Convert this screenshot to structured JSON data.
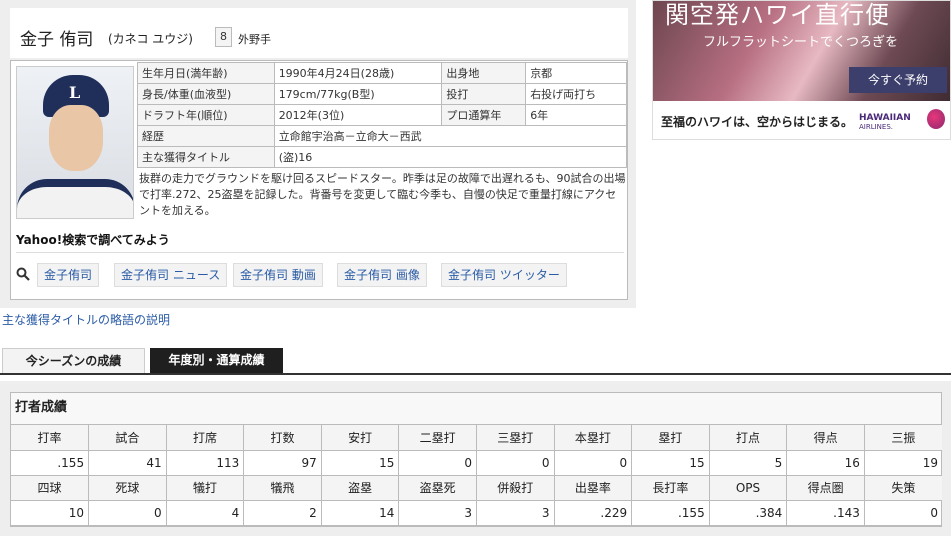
{
  "player": {
    "name": "金子 侑司",
    "kana": "(カネコ ユウジ)",
    "number": "8",
    "position": "外野手"
  },
  "info": {
    "rows": [
      {
        "l1": "生年月日(満年齢)",
        "v1": "1990年4月24日(28歳)",
        "l2": "出身地",
        "v2": "京都"
      },
      {
        "l1": "身長/体重(血液型)",
        "v1": "179cm/77kg(B型)",
        "l2": "投打",
        "v2": "右投げ両打ち"
      },
      {
        "l1": "ドラフト年(順位)",
        "v1": "2012年(3位)",
        "l2": "プロ通算年",
        "v2": "6年"
      }
    ],
    "career_label": "経歴",
    "career": "立命館宇治高－立命大－西武",
    "title_label": "主な獲得タイトル",
    "title": "(盗)16",
    "description": "抜群の走力でグラウンドを駆け回るスピードスター。昨季は足の故障で出遅れるも、90試合の出場で打率.272、25盗塁を記録した。背番号を変更して臨む今季も、自慢の快足で重量打線にアクセントを加える。"
  },
  "yahoo": {
    "heading": "Yahoo!検索で調べてみよう",
    "links": [
      "金子侑司",
      "金子侑司 ニュース",
      "金子侑司 動画",
      "金子侑司 画像",
      "金子侑司 ツイッター"
    ]
  },
  "ad": {
    "title": "関空発ハワイ直行便",
    "subtitle": "フルフラットシートでくつろぎを",
    "button": "今すぐ予約",
    "footer": "至福のハワイは、空からはじまる。",
    "brand": "HAWAIIAN",
    "brand_sub": "AIRLINES."
  },
  "legend_link": "主な獲得タイトルの略語の説明",
  "tabs": [
    "今シーズンの成績",
    "年度別・通算成績"
  ],
  "stats": {
    "title": "打者成績",
    "headers1": [
      "打率",
      "試合",
      "打席",
      "打数",
      "安打",
      "二塁打",
      "三塁打",
      "本塁打",
      "塁打",
      "打点",
      "得点",
      "三振"
    ],
    "values1": [
      ".155",
      "41",
      "113",
      "97",
      "15",
      "0",
      "0",
      "0",
      "15",
      "5",
      "16",
      "19"
    ],
    "headers2": [
      "四球",
      "死球",
      "犠打",
      "犠飛",
      "盗塁",
      "盗塁死",
      "併殺打",
      "出塁率",
      "長打率",
      "OPS",
      "得点圏",
      "失策"
    ],
    "values2": [
      "10",
      "0",
      "4",
      "2",
      "14",
      "3",
      "3",
      ".229",
      ".155",
      ".384",
      ".143",
      "0"
    ]
  }
}
